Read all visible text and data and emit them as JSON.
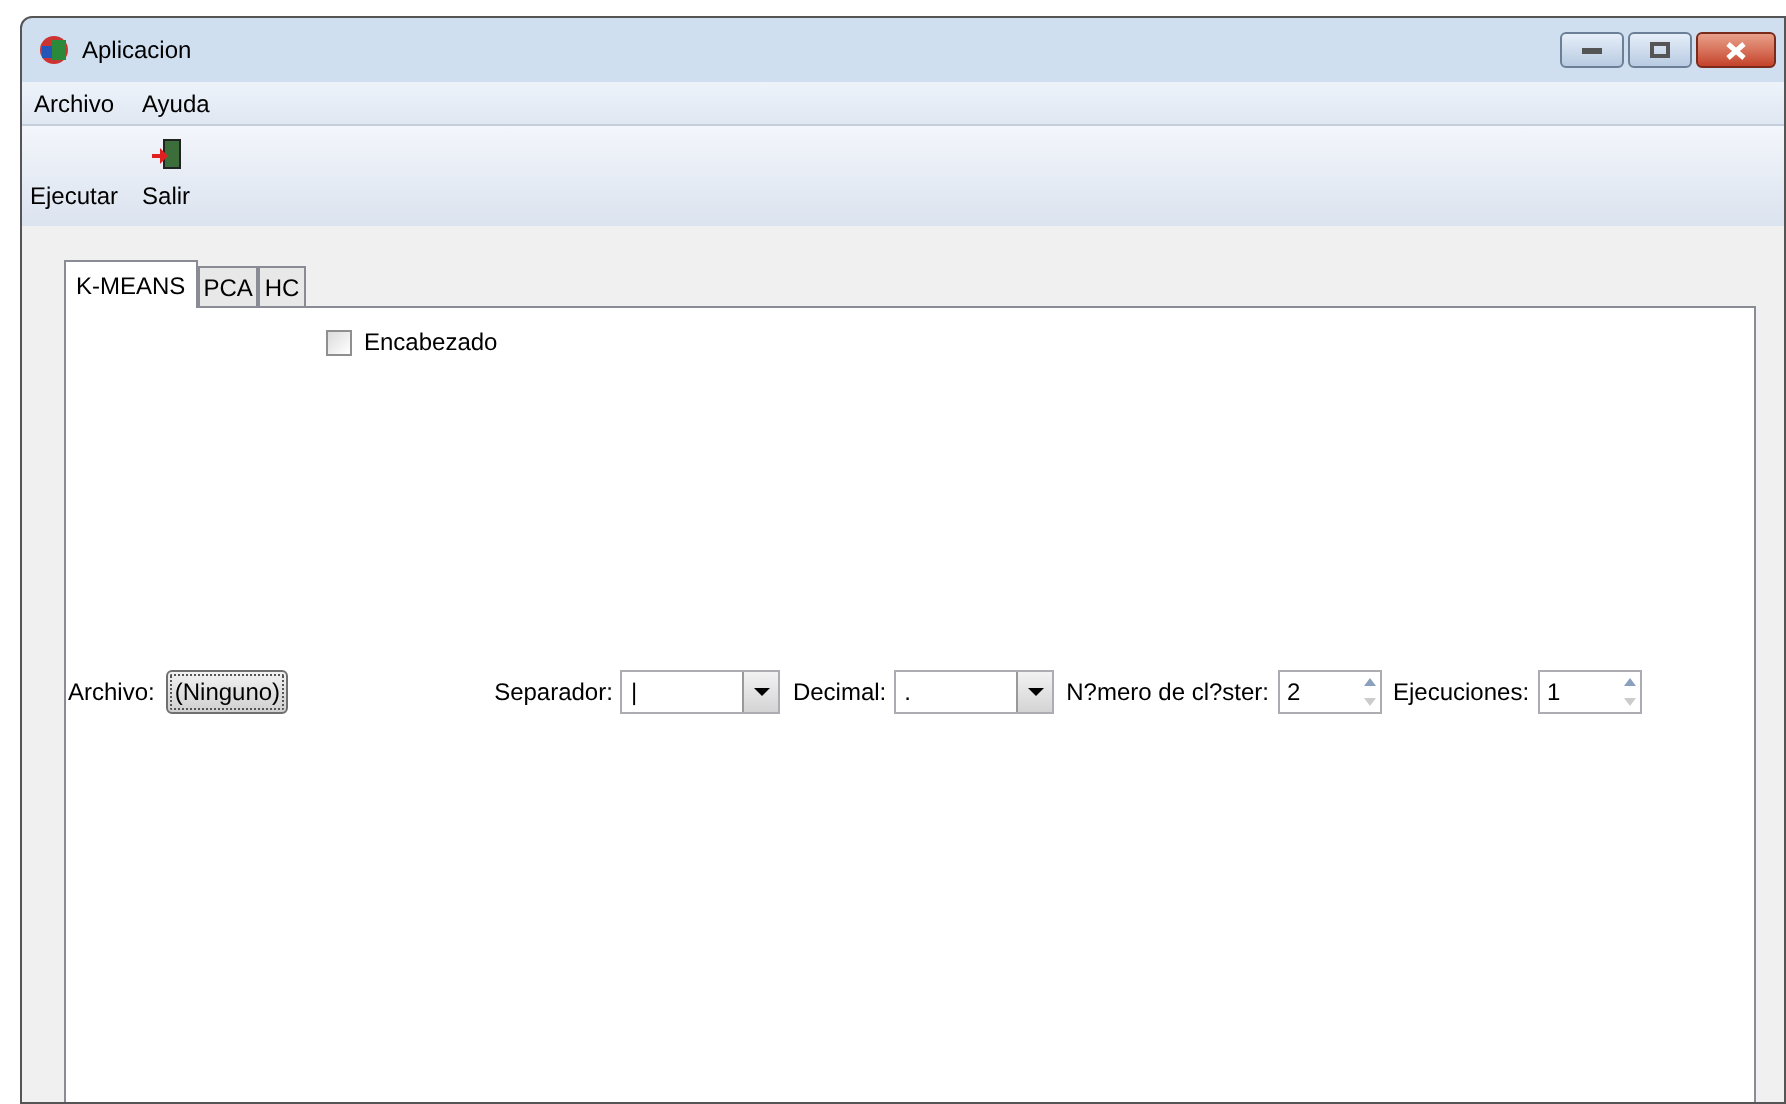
{
  "window": {
    "title": "Aplicacion"
  },
  "menu": [
    "Archivo",
    "Ayuda"
  ],
  "toolbar": [
    {
      "label": "Ejecutar",
      "kind": "text"
    },
    {
      "label": "Salir",
      "kind": "exit"
    }
  ],
  "tabs": [
    {
      "label": "K-MEANS",
      "selected": true
    },
    {
      "label": "PCA",
      "selected": false
    },
    {
      "label": "HC",
      "selected": false
    }
  ],
  "header_checkbox": {
    "label": "Encabezado",
    "checked": false
  },
  "file": {
    "label": "Archivo:",
    "button": "(Ninguno)"
  },
  "separator": {
    "label": "Separador:",
    "value": "|"
  },
  "decimal": {
    "label": "Decimal:",
    "value": "."
  },
  "clusters": {
    "label": "N?mero de cl?ster:",
    "value": "2"
  },
  "runs": {
    "label": "Ejecuciones:",
    "value": "1"
  }
}
